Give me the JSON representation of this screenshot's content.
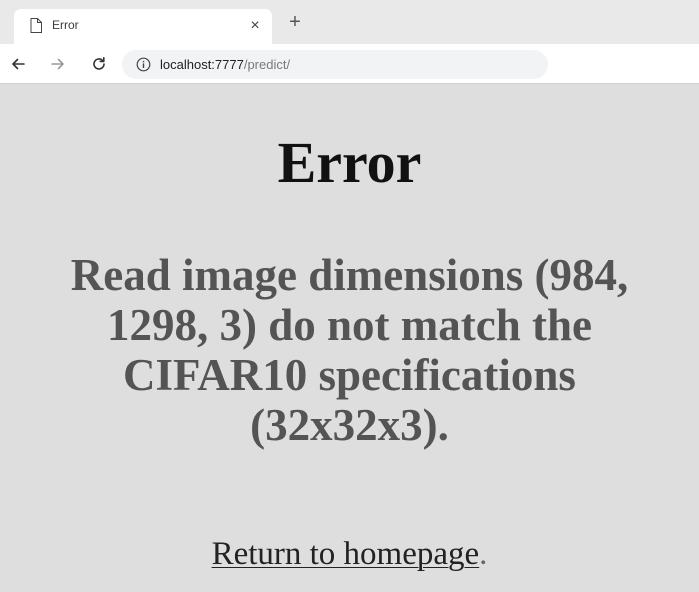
{
  "browser": {
    "tab": {
      "title": "Error",
      "close_glyph": "×",
      "icon": "page-icon"
    },
    "new_tab_glyph": "+",
    "toolbar": {
      "back_icon": "arrow-left-icon",
      "forward_icon": "arrow-right-icon",
      "reload_icon": "reload-icon",
      "info_icon": "info-icon",
      "url_host": "localhost:7777",
      "url_path": "/predict/"
    }
  },
  "page": {
    "heading": "Error",
    "message": "Read image dimensions (984, 1298, 3) do not match the CIFAR10 specifications (32x32x3).",
    "link_text": "Return to homepage",
    "link_trailing": "."
  },
  "colors": {
    "page_background": "#dedede",
    "heading": "#111111",
    "message": "#545454"
  }
}
